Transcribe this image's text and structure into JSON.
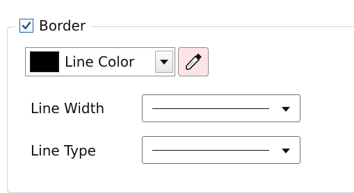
{
  "border_group": {
    "checkbox_checked": true,
    "label": "Border"
  },
  "line_color": {
    "label": "Line Color",
    "swatch_color": "#000000",
    "picker_icon": "eyedropper-icon"
  },
  "line_width": {
    "label": "Line Width",
    "selected": "solid-line"
  },
  "line_type": {
    "label": "Line Type",
    "selected": "solid-line"
  },
  "colors": {
    "group_border": "#c8d6e3",
    "checkbox_border": "#2d5e8f",
    "checkmark": "#1d4f91",
    "picker_bg": "#fde5e5"
  }
}
